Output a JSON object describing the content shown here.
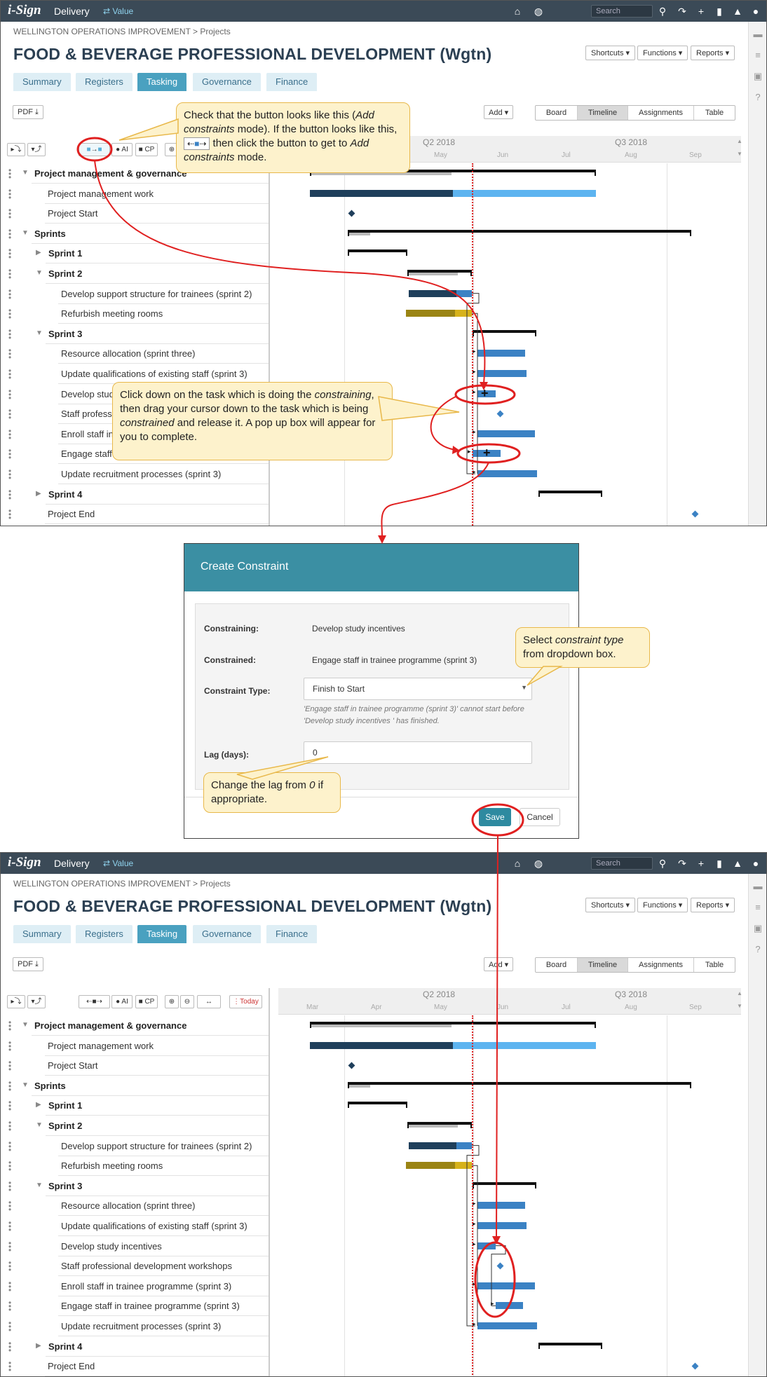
{
  "app": {
    "logo": "i-Sign",
    "name": "Delivery",
    "value_link": "⇄ Value",
    "search_placeholder": "Search"
  },
  "breadcrumb": "WELLINGTON OPERATIONS IMPROVEMENT > Projects",
  "page_title": "FOOD & BEVERAGE PROFESSIONAL DEVELOPMENT (Wgtn)",
  "header_buttons": {
    "shortcuts": "Shortcuts ▾",
    "functions": "Functions ▾",
    "reports": "Reports ▾"
  },
  "tabs": [
    "Summary",
    "Registers",
    "Tasking",
    "Governance",
    "Finance"
  ],
  "active_tab": "Tasking",
  "pdf_button": "PDF ⤓",
  "add_button": "Add ▾",
  "views": [
    "Board",
    "Timeline",
    "Assignments",
    "Table"
  ],
  "active_view": "Timeline",
  "gantt_tools": {
    "ai": "AI",
    "cp": "CP",
    "today": "Today"
  },
  "timeline": {
    "quarters": [
      "Q2 2018",
      "Q3 2018"
    ],
    "months": [
      "Mar",
      "Apr",
      "May",
      "Jun",
      "Jul",
      "Aug",
      "Sep"
    ]
  },
  "tasks_before": [
    {
      "label": "Project management & governance",
      "level": 0,
      "bold": true,
      "expand": "down"
    },
    {
      "label": "Project management work",
      "level": 2
    },
    {
      "label": "Project Start",
      "level": 2
    },
    {
      "label": "Sprints",
      "level": 0,
      "bold": true,
      "expand": "down"
    },
    {
      "label": "Sprint 1",
      "level": 1,
      "bold": true,
      "expand": "right"
    },
    {
      "label": "Sprint 2",
      "level": 1,
      "bold": true,
      "expand": "down"
    },
    {
      "label": "Develop support structure for trainees (sprint 2)",
      "level": 3
    },
    {
      "label": "Refurbish meeting rooms",
      "level": 3
    },
    {
      "label": "Sprint 3",
      "level": 1,
      "bold": true,
      "expand": "down"
    },
    {
      "label": "Resource allocation (sprint three)",
      "level": 3
    },
    {
      "label": "Update qualifications of existing staff (sprint 3)",
      "level": 3
    },
    {
      "label": "Develop study incentives",
      "level": 3
    },
    {
      "label": "Staff professional development workshops",
      "level": 3
    },
    {
      "label": "Enroll staff in trainee programme (sprint 3)",
      "level": 3
    },
    {
      "label": "Engage staff in trainee programme (sprint 3)",
      "level": 3
    },
    {
      "label": "Update recruitment processes (sprint 3)",
      "level": 3
    },
    {
      "label": "Sprint 4",
      "level": 1,
      "bold": true,
      "expand": "right"
    },
    {
      "label": "Project End",
      "level": 2
    }
  ],
  "callouts": {
    "button_check": "Check that the button looks like this (<i>Add constraints</i> mode). If the button looks like this, [⇠■⇢] then click the button to get to <i>Add constraints</i> mode.",
    "drag": "Click down on the task which is doing the <i>constraining</i>, then drag your cursor down to the task which is being <i>constrained</i> and release it. A pop up box will appear for you to complete.",
    "constraint_type": "Select <i>constraint type</i> from dropdown box.",
    "lag": "Change the lag from <i>0</i> if appropriate."
  },
  "modal": {
    "title": "Create Constraint",
    "constraining_label": "Constraining:",
    "constraining_value": "Develop study incentives",
    "constrained_label": "Constrained:",
    "constrained_value": "Engage staff in trainee programme (sprint 3)",
    "type_label": "Constraint Type:",
    "type_value": "Finish to Start",
    "help": "'Engage staff in trainee programme (sprint 3)' cannot start before 'Develop study incentives ' has finished.",
    "lag_label": "Lag (days):",
    "lag_value": "0",
    "save": "Save",
    "cancel": "Cancel"
  },
  "colors": {
    "topbar": "#3b4a57",
    "accent": "#4aa1c0",
    "bar_dark": "#1f3f5b",
    "bar_mid": "#3b82c4",
    "bar_light": "#5db4f0",
    "bar_olive": "#9a8414",
    "bar_gold": "#d6b21b",
    "callout_bg": "#fdf2cc",
    "callout_border": "#e8b84a",
    "annotation_red": "#e02020"
  }
}
